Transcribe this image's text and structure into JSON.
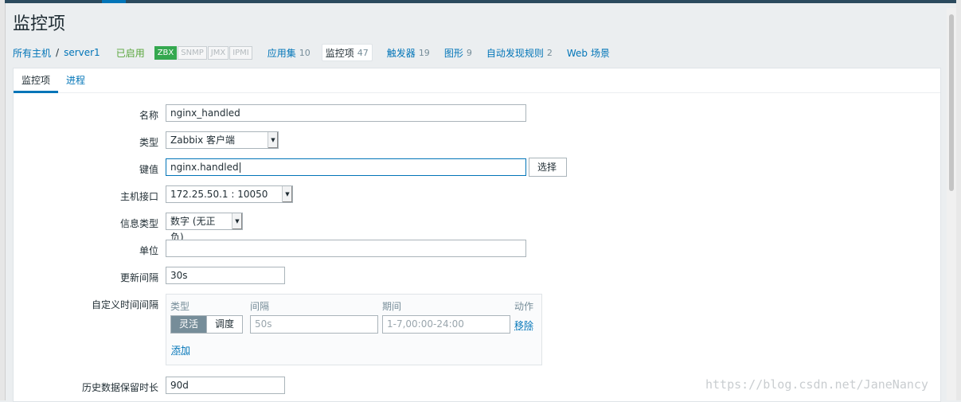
{
  "page": {
    "title": "监控项"
  },
  "breadcrumb": {
    "all_hosts": "所有主机",
    "separator": "/",
    "host": "server1"
  },
  "status": {
    "enabled": "已启用"
  },
  "availability_tags": [
    "ZBX",
    "SNMP",
    "JMX",
    "IPMI"
  ],
  "nav_items": [
    {
      "label": "应用集",
      "count": "10"
    },
    {
      "label": "监控项",
      "count": "47"
    },
    {
      "label": "触发器",
      "count": "19"
    },
    {
      "label": "图形",
      "count": "9"
    },
    {
      "label": "自动发现规则",
      "count": "2"
    },
    {
      "label": "Web 场景",
      "count": ""
    }
  ],
  "tabs": {
    "item": "监控项",
    "process": "进程"
  },
  "form": {
    "name_label": "名称",
    "name_value": "nginx_handled",
    "type_label": "类型",
    "type_value": "Zabbix 客户端",
    "key_label": "键值",
    "key_value": "nginx.handled",
    "select_button": "选择",
    "interface_label": "主机接口",
    "interface_value": "172.25.50.1 : 10050",
    "info_type_label": "信息类型",
    "info_type_value": "数字 (无正负)",
    "units_label": "单位",
    "units_value": "",
    "interval_label": "更新间隔",
    "interval_value": "30s",
    "custom_intervals_label": "自定义时间间隔",
    "history_label": "历史数据保留时长",
    "history_value": "90d"
  },
  "custom_intervals": {
    "col_type": "类型",
    "col_interval": "间隔",
    "col_period": "期间",
    "col_action": "动作",
    "type_flexible": "灵活",
    "type_scheduling": "调度",
    "interval_placeholder": "50s",
    "period_placeholder": "1-7,00:00-24:00",
    "remove": "移除",
    "add": "添加"
  },
  "watermark": "https://blog.csdn.net/JaneNancy",
  "colors": {
    "accent": "#0275b8",
    "enabled": "#59a63c",
    "zbx": "#34a84f"
  }
}
